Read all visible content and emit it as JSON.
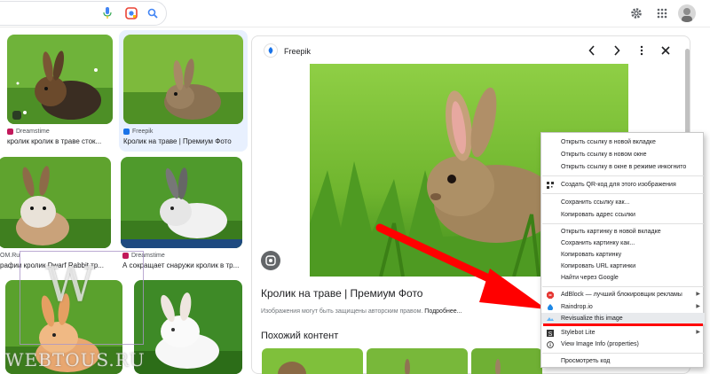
{
  "header": {
    "mic_icon": "mic-icon",
    "lens_icon": "lens-icon",
    "search_icon": "search-icon",
    "settings_icon": "gear-icon",
    "apps_icon": "apps-grid-icon"
  },
  "results": [
    {
      "source": "Dreamstime",
      "caption": "кролик кролик в траве сток...",
      "fav_color": "#c2185b"
    },
    {
      "source": "Freepik",
      "caption": "Кролик на траве | Премиум Фото",
      "fav_color": "#1a73e8"
    },
    {
      "source": "",
      "caption": "",
      "fav_color": ""
    },
    {
      "source": "Dreamstime",
      "caption": "",
      "fav_color": "#c2185b"
    },
    {
      "source": "OM.Ru",
      "caption": "рафии кролик Dwarf Rabbit тр...",
      "fav_color": ""
    },
    {
      "source": "Dreamstime",
      "caption": "А сокращает снаружи кролик в тр...",
      "fav_color": "#c2185b"
    }
  ],
  "panel": {
    "source": "Freepik",
    "title": "Кролик на траве | Премиум Фото",
    "note": "Изображения могут быть защищены авторским правом.",
    "note_more": "Подробнее...",
    "similar_heading": "Похожий контент"
  },
  "context_menu": {
    "items": [
      "Открыть ссылку в новой вкладке",
      "Открыть ссылку в новом окне",
      "Открыть ссылку в окне в режиме инкогнито",
      "Создать QR-код для этого изображения",
      "Сохранить ссылку как...",
      "Копировать адрес ссылки",
      "Открыть картинку в новой вкладке",
      "Сохранить картинку как...",
      "Копировать картинку",
      "Копировать URL картинки",
      "Найти через Google",
      "AdBlock — лучший блокировщик рекламы",
      "Raindrop.io",
      "Revisualize this image",
      "Stylebot Lite",
      "View Image Info (properties)",
      "Просмотреть код"
    ],
    "highlight_color": "#ff0000"
  },
  "watermark": {
    "text": "WEBTOUS.RU",
    "letter": "W"
  }
}
